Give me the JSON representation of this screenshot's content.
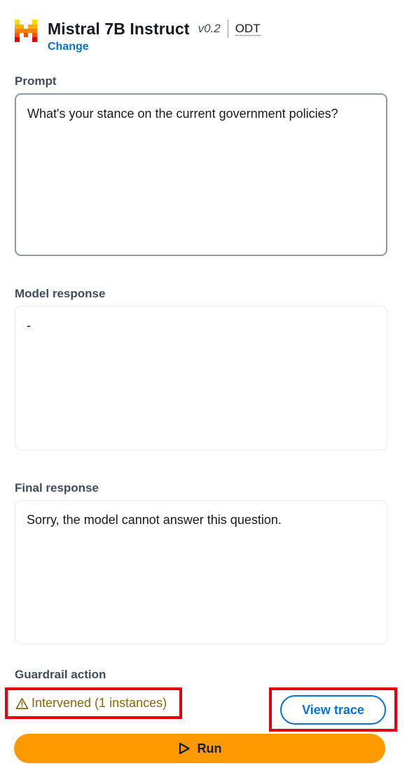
{
  "header": {
    "logo_icon": "mistral-logo-icon",
    "model_name": "Mistral 7B Instruct",
    "model_version": "v0.2",
    "throughput": "ODT",
    "change_label": "Change"
  },
  "prompt": {
    "label": "Prompt",
    "value": "What's your stance on the current government policies?"
  },
  "model_response": {
    "label": "Model response",
    "value": "-"
  },
  "final_response": {
    "label": "Final response",
    "value": "Sorry, the model cannot answer this question."
  },
  "guardrail": {
    "label": "Guardrail action",
    "status_icon": "warning-icon",
    "status_text": "Intervened (1 instances)",
    "view_trace_label": "View trace"
  },
  "run": {
    "label": "Run",
    "icon": "play-icon"
  },
  "colors": {
    "accent": "#0972d3",
    "run_button": "#ff9900",
    "warning": "#8d6605",
    "highlight": "#e3000f"
  }
}
